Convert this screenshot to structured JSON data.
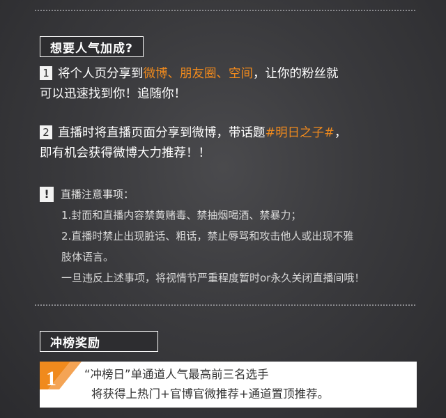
{
  "section1": {
    "title": "想要人气加成?",
    "items": [
      {
        "num": "1",
        "line1_pre": "将个人页分享到",
        "line1_hl": "微博、朋友圈、空间",
        "line1_post": "，让你的粉丝就",
        "line2": "可以迅速找到你！追随你！"
      },
      {
        "num": "2",
        "line1_pre": "直播时将直播页面分享到微博，带话题",
        "line1_hl": "#明日之子#",
        "line1_post": "，",
        "line2": "即有机会获得微博大力推荐！！"
      }
    ],
    "notice": {
      "icon": "!",
      "title": "直播注意事项：",
      "lines": [
        "1.封面和直播内容禁黄赌毒、禁抽烟喝酒、禁暴力；",
        "2.直播时禁止出现脏话、粗话，禁止辱骂和攻击他人或出现不雅",
        "肢体语言。",
        "一旦违反上述事项，将视情节严重程度暂时or永久关闭直播间哦！"
      ]
    }
  },
  "section2": {
    "title": "冲榜奖励",
    "reward": {
      "badge_num": "1",
      "line1": "“冲榜日”单通道人气最高前三名选手",
      "line2": "将获得上热门+官博官微推荐+通道置顶推荐。"
    }
  },
  "colors": {
    "accent": "#f08a1d",
    "background": "#3a3a3d",
    "text": "#ffffff"
  }
}
